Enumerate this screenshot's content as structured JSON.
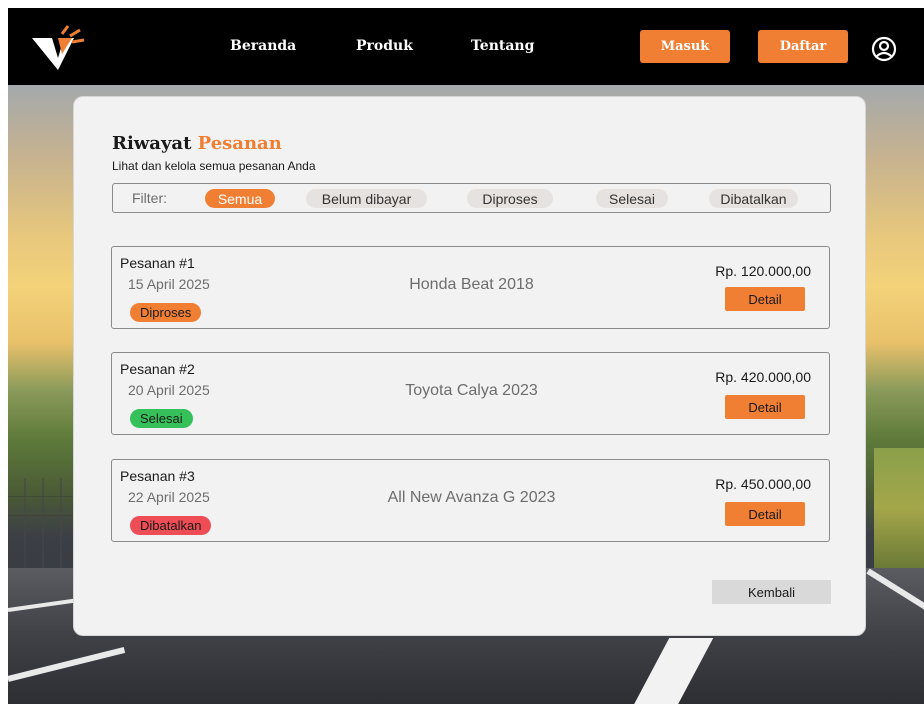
{
  "navbar": {
    "links": [
      "Beranda",
      "Produk",
      "Tentang"
    ],
    "login_label": "Masuk",
    "register_label": "Daftar",
    "brand_color": "#f07f34",
    "icons": [
      "logo",
      "user-profile-icon"
    ]
  },
  "page": {
    "title_part1": "Riwayat ",
    "title_part2": "Pesanan",
    "subtitle": "Lihat dan kelola semua pesanan Anda"
  },
  "filter": {
    "label": "Filter:",
    "options": [
      "Semua",
      "Belum dibayar",
      "Diproses",
      "Selesai",
      "Dibatalkan"
    ],
    "active": "Semua"
  },
  "orders": [
    {
      "id": "Pesanan #1",
      "date": "15 April 2025",
      "status": "Diproses",
      "status_color": "#f07f34",
      "product": "Honda Beat 2018",
      "price": "Rp. 120.000,00",
      "action": "Detail"
    },
    {
      "id": "Pesanan #2",
      "date": "20 April 2025",
      "status": "Selesai",
      "status_color": "#35c05a",
      "product": "Toyota Calya 2023",
      "price": "Rp. 420.000,00",
      "action": "Detail"
    },
    {
      "id": "Pesanan #3",
      "date": "22 April 2025",
      "status": "Dibatalkan",
      "status_color": "#ee4d55",
      "product": "All New Avanza G 2023",
      "price": "Rp. 450.000,00",
      "action": "Detail"
    }
  ],
  "back_label": "Kembali"
}
